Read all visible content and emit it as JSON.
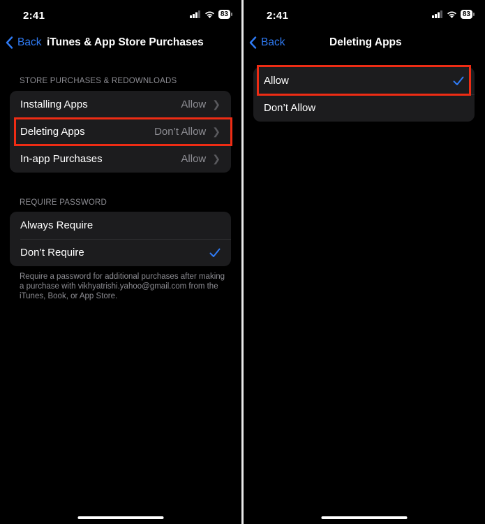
{
  "left": {
    "status": {
      "time": "2:41",
      "battery": "83"
    },
    "nav": {
      "back_label": "Back",
      "title": "iTunes & App Store Purchases"
    },
    "section1": {
      "header": "STORE PURCHASES & REDOWNLOADS",
      "rows": [
        {
          "label": "Installing Apps",
          "value": "Allow"
        },
        {
          "label": "Deleting Apps",
          "value": "Don’t Allow"
        },
        {
          "label": "In-app Purchases",
          "value": "Allow"
        }
      ]
    },
    "section2": {
      "header": "REQUIRE PASSWORD",
      "rows": [
        {
          "label": "Always Require",
          "selected": false
        },
        {
          "label": "Don’t Require",
          "selected": true
        }
      ],
      "footer": "Require a password for additional purchases after making a purchase with vikhyatrishi.yahoo@gmail.com from the iTunes, Book, or App Store."
    }
  },
  "right": {
    "status": {
      "time": "2:41",
      "battery": "83"
    },
    "nav": {
      "back_label": "Back",
      "title": "Deleting Apps"
    },
    "options": [
      {
        "label": "Allow",
        "selected": true
      },
      {
        "label": "Don’t Allow",
        "selected": false
      }
    ]
  },
  "colors": {
    "accent": "#2f7bf5",
    "highlight": "#ee2c14",
    "card": "#1c1c1e",
    "secondary_text": "#8d8d93"
  }
}
